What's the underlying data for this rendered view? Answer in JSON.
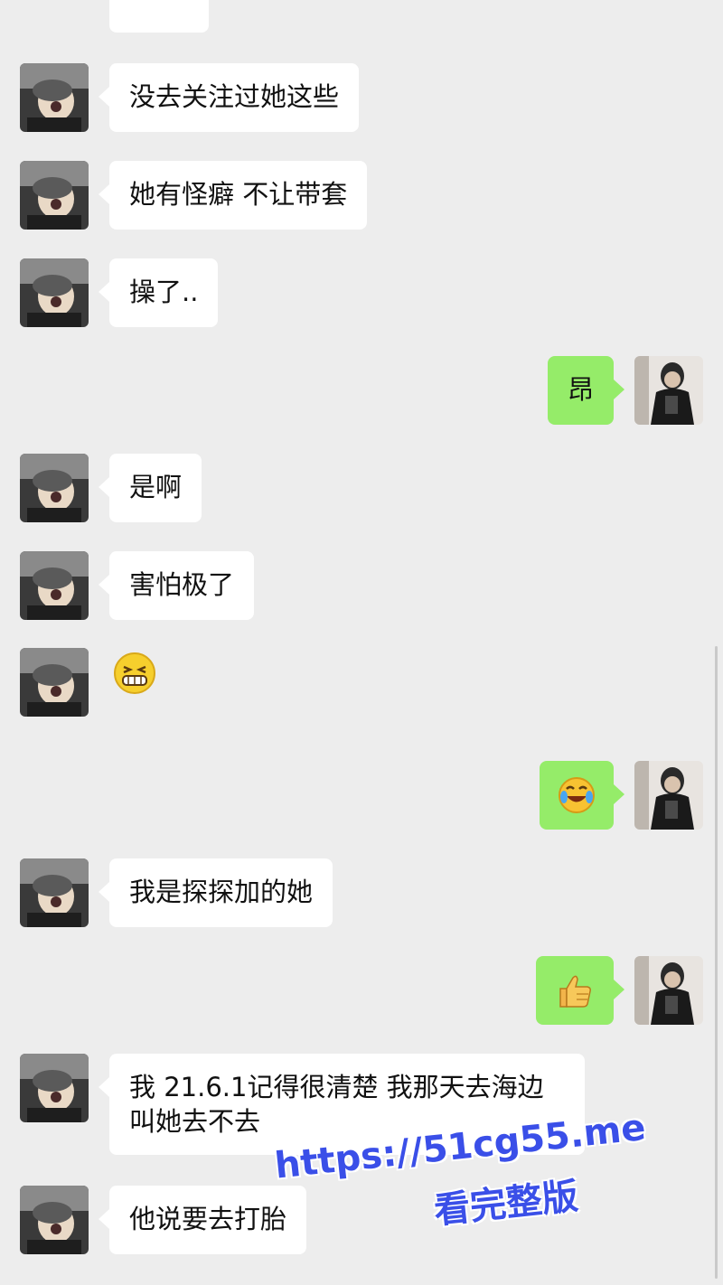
{
  "watermark": {
    "url": "https://51cg55.me",
    "subtitle": "看完整版"
  },
  "colors": {
    "background": "#ededed",
    "incoming_bubble": "#ffffff",
    "outgoing_bubble": "#95ec69",
    "watermark": "#3a4fe8"
  },
  "messages": [
    {
      "direction": "in",
      "type": "text",
      "text": "没去关注过她这些"
    },
    {
      "direction": "in",
      "type": "text",
      "text": "她有怪癖 不让带套"
    },
    {
      "direction": "in",
      "type": "text",
      "text": "操了.."
    },
    {
      "direction": "out",
      "type": "text",
      "text": "昂"
    },
    {
      "direction": "in",
      "type": "text",
      "text": "是啊"
    },
    {
      "direction": "in",
      "type": "text",
      "text": "害怕极了"
    },
    {
      "direction": "in",
      "type": "emoji",
      "icon": "grimace-laugh-emoji-icon"
    },
    {
      "direction": "out",
      "type": "emoji",
      "icon": "crying-laughing-emoji-icon"
    },
    {
      "direction": "in",
      "type": "text",
      "text": "我是探探加的她"
    },
    {
      "direction": "out",
      "type": "emoji",
      "icon": "thumbs-up-emoji-icon"
    },
    {
      "direction": "in",
      "type": "text",
      "text": "我 21.6.1记得很清楚 我那天去海边\n叫她去不去"
    },
    {
      "direction": "in",
      "type": "text",
      "text": "他说要去打胎"
    }
  ]
}
